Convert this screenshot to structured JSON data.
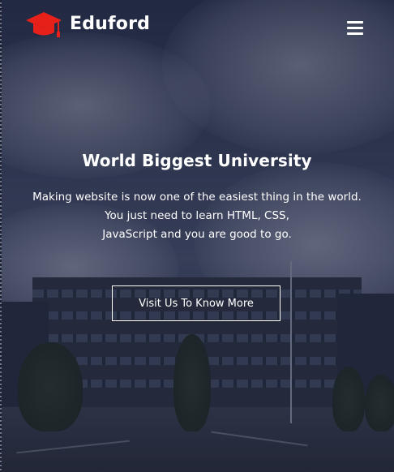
{
  "brand": {
    "name": "Eduford",
    "logo_icon": "graduation-cap-icon",
    "logo_color": "#e8201a"
  },
  "nav": {
    "menu_icon": "hamburger-menu-icon"
  },
  "hero": {
    "title": "World Biggest University",
    "description_lines": [
      "Making website is now one of the easiest thing in the world.",
      "You just need to learn HTML, CSS,",
      "JavaScript and you are good to go."
    ],
    "cta_label": "Visit Us To Know More",
    "background": "university-building-photo"
  }
}
